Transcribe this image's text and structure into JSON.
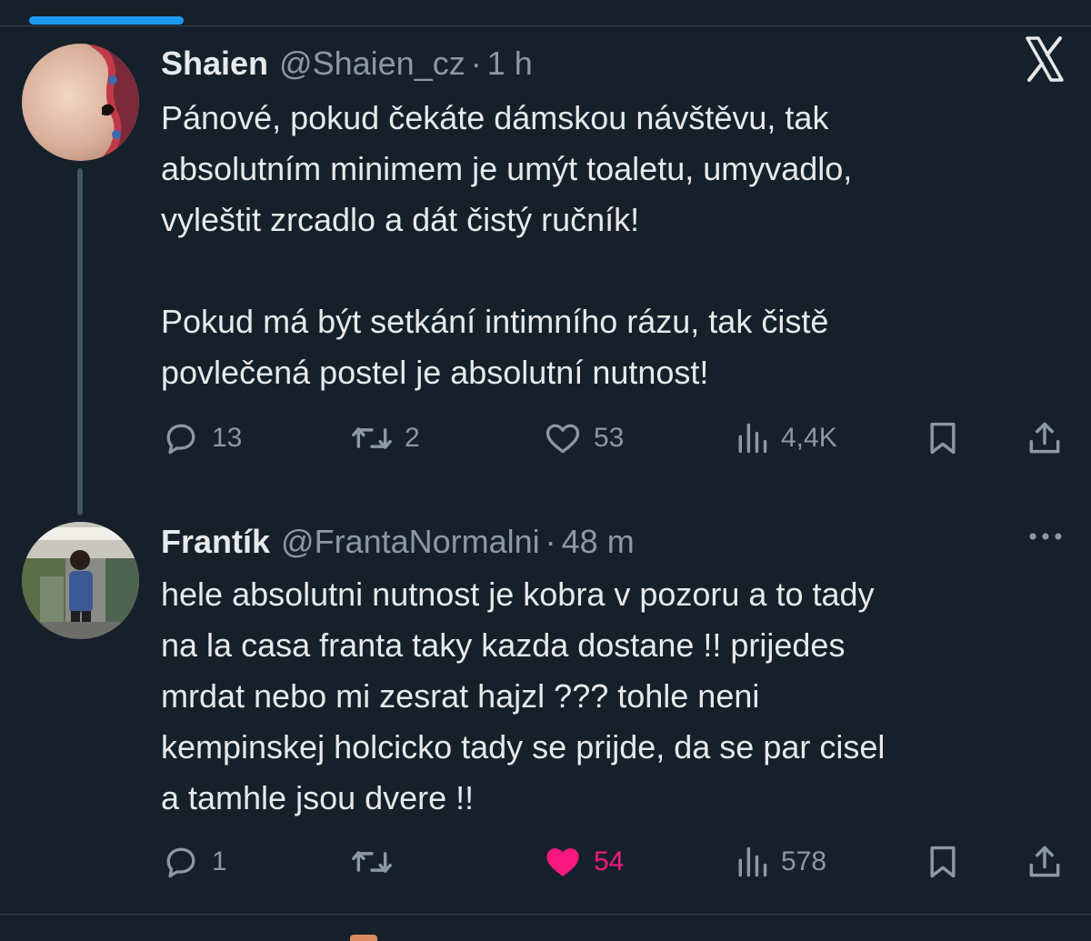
{
  "tweets": [
    {
      "display_name": "Shaien",
      "handle": "@Shaien_cz",
      "separator": "·",
      "time": "1 h",
      "text": "Pánové, pokud čekáte dámskou návštěvu, tak\nabsolutním minimem je umýt toaletu, umyvadlo,\nvyleštit zrcadlo a dát čistý ručník!\n\nPokud má být setkání intimního rázu, tak čistě\npovlečená postel je absolutní nutnost!",
      "replies": "13",
      "reposts": "2",
      "likes": "53",
      "views": "4,4K",
      "liked": false,
      "corner_icon": "x-logo-icon"
    },
    {
      "display_name": "Frantík",
      "handle": "@FrantaNormalni",
      "separator": "·",
      "time": "48 m",
      "text": "hele absolutni nutnost je kobra v pozoru a to tady\nna la casa franta taky kazda dostane !! prijedes\nmrdat nebo mi zesrat hajzl ??? tohle neni\nkempinskej holcicko tady se prijde, da se par cisel\na tamhle jsou dvere !!",
      "replies": "1",
      "reposts": "",
      "likes": "54",
      "views": "578",
      "liked": true,
      "corner_icon": "more-icon"
    }
  ],
  "colors": {
    "background": "#15202b",
    "text": "#e7e9ea",
    "muted": "#8b98a5",
    "accent": "#1d9bf0",
    "like": "#f91880"
  }
}
